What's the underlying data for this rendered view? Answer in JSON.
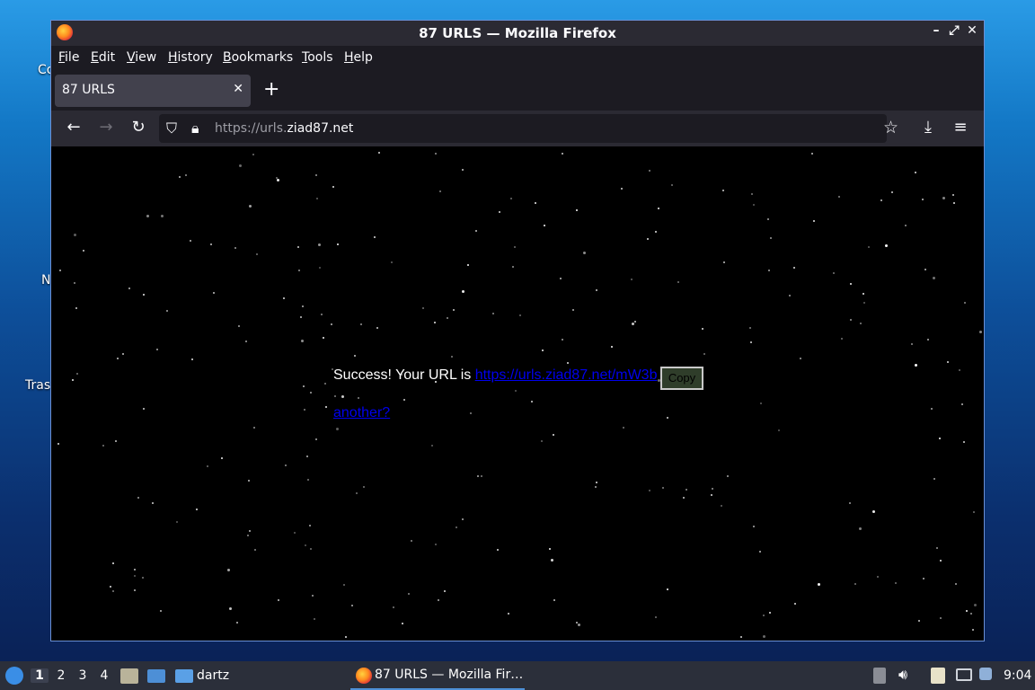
{
  "desktop": {
    "labels": [
      "Co",
      "N",
      "Tras"
    ]
  },
  "window": {
    "title": "87 URLS — Mozilla Firefox",
    "controls": [
      "–",
      "⤢",
      "✕"
    ]
  },
  "menubar": {
    "items": [
      "File",
      "Edit",
      "View",
      "History",
      "Bookmarks",
      "Tools",
      "Help"
    ]
  },
  "tabs": [
    {
      "label": "87 URLS",
      "close": "✕"
    }
  ],
  "newtab_label": "+",
  "navbar": {
    "back": "←",
    "forward": "→",
    "reload": "↻",
    "url_prefix": "https://urls.",
    "url_host": "ziad87.net",
    "bookmark": "☆",
    "downloads": "⤓",
    "menu": "≡"
  },
  "page": {
    "success_text": "Success! Your URL is ",
    "short_url": "https://urls.ziad87.net/mW3b",
    "copy_label": "Copy",
    "another_label": "another?"
  },
  "taskbar": {
    "workspaces": [
      "1",
      "2",
      "3",
      "4"
    ],
    "folder_label": "dartz",
    "task_label": "87 URLS — Mozilla Fir…",
    "clock": "9:04"
  }
}
